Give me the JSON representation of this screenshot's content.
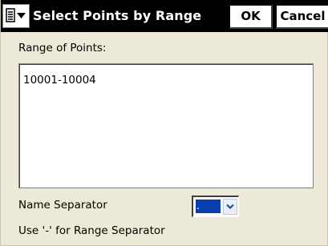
{
  "window": {
    "title": "Select Points by Range",
    "menu_icon": "menu-dropdown-icon"
  },
  "titlebar": {
    "ok_label": "OK",
    "cancel_label": "Cancel"
  },
  "range": {
    "label": "Range of Points:",
    "value": "10001-10004"
  },
  "separator": {
    "label": "Name Separator",
    "selected": ".",
    "dropdown_icon": "chevron-down-icon",
    "hint": "Use '-' for Range Separator"
  },
  "colors": {
    "titlebar_bg": "#000000",
    "dialog_bg": "#ece9d8",
    "selection_bg": "#0a3fb0"
  }
}
